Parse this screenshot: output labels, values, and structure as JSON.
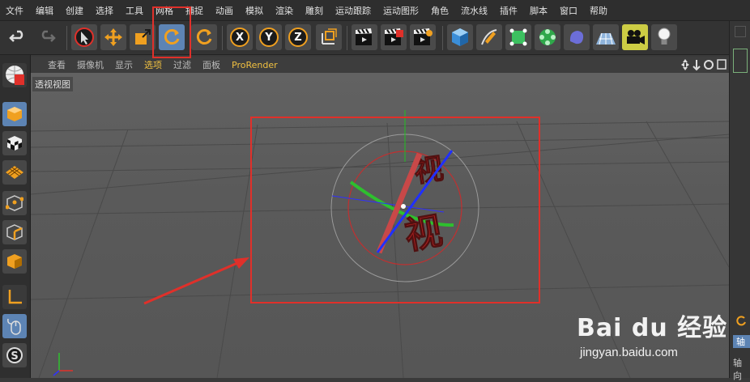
{
  "menu": [
    "文件",
    "编辑",
    "创建",
    "选择",
    "工具",
    "网格",
    "捕捉",
    "动画",
    "模拟",
    "渲染",
    "雕刻",
    "运动跟踪",
    "运动图形",
    "角色",
    "流水线",
    "插件",
    "脚本",
    "窗口",
    "帮助"
  ],
  "toolbar": {
    "undo_icon": "undo-icon",
    "axis_x": "X",
    "axis_y": "Y",
    "axis_z": "Z",
    "active_tool": "rotate"
  },
  "viewport": {
    "menu": [
      "查看",
      "摄像机",
      "显示",
      "选项",
      "过滤",
      "面板",
      "ProRender"
    ],
    "active_menu": "选项",
    "label": "透视视图",
    "model_text": "视"
  },
  "right_panel": {
    "tab1": "轴",
    "tab2": "轴向"
  },
  "watermark": {
    "brand": "Bai du 经验",
    "url": "jingyan.baidu.com"
  },
  "colors": {
    "accent_orange": "#f0a020",
    "selection_blue": "#5d84b4",
    "annotation_red": "#e0302a"
  }
}
